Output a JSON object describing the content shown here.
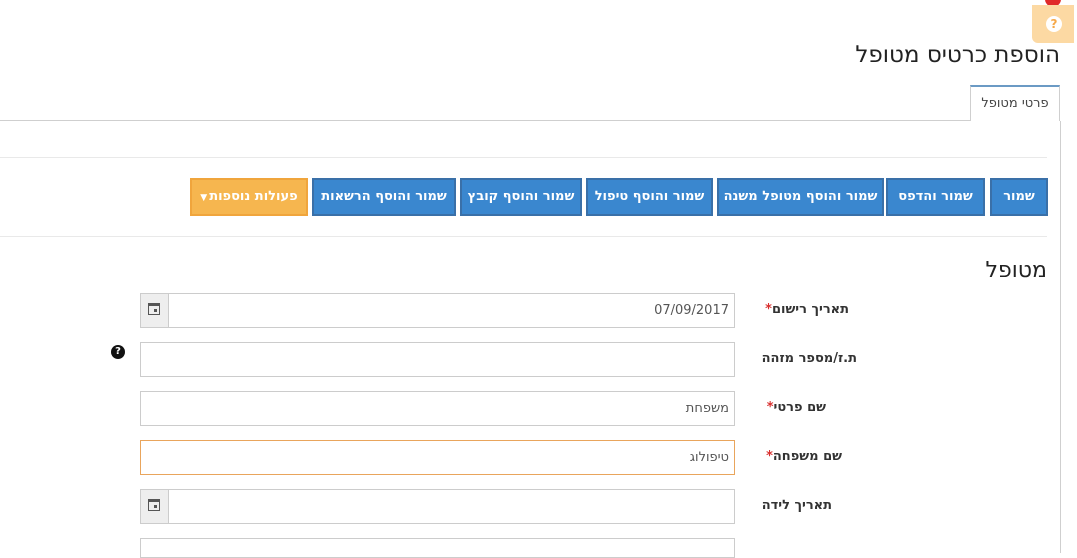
{
  "page": {
    "title": "הוספת כרטיס מטופל",
    "help_icon": "question-circle-icon"
  },
  "tabs": [
    {
      "label": "פרטי מטופל",
      "active": true
    }
  ],
  "toolbar": {
    "buttons": [
      {
        "label": "שמור"
      },
      {
        "label": "שמור והדפס"
      },
      {
        "label": "שמור והוסף מטופל משנה"
      },
      {
        "label": "שמור והוסף טיפול"
      },
      {
        "label": "שמור והוסף קובץ"
      },
      {
        "label": "שמור והוסף הרשאות"
      }
    ],
    "more_actions": {
      "label": "פעולות נוספות",
      "icon": "caret-down-icon"
    }
  },
  "section": {
    "title": "מטופל"
  },
  "form": {
    "registration_date": {
      "label": "תאריך רישום",
      "required_mark": "*",
      "value": "07/09/2017",
      "icon": "calendar-icon"
    },
    "id_number": {
      "label": "ת.ז/מספר מזהה",
      "value": "",
      "help_icon": "question-circle-icon",
      "help_glyph": "?"
    },
    "first_name": {
      "label": "שם פרטי",
      "required_mark": "*",
      "value": "משפחת"
    },
    "last_name": {
      "label": "שם משפחה",
      "required_mark": "*",
      "value": "טיפולוג"
    },
    "birth_date": {
      "label": "תאריך לידה",
      "value": "",
      "icon": "calendar-icon"
    }
  },
  "colors": {
    "primary_button": "#3a87cf",
    "orange_button": "#f6b64f",
    "required": "#d9302f",
    "focus_border": "#e9a55c"
  }
}
